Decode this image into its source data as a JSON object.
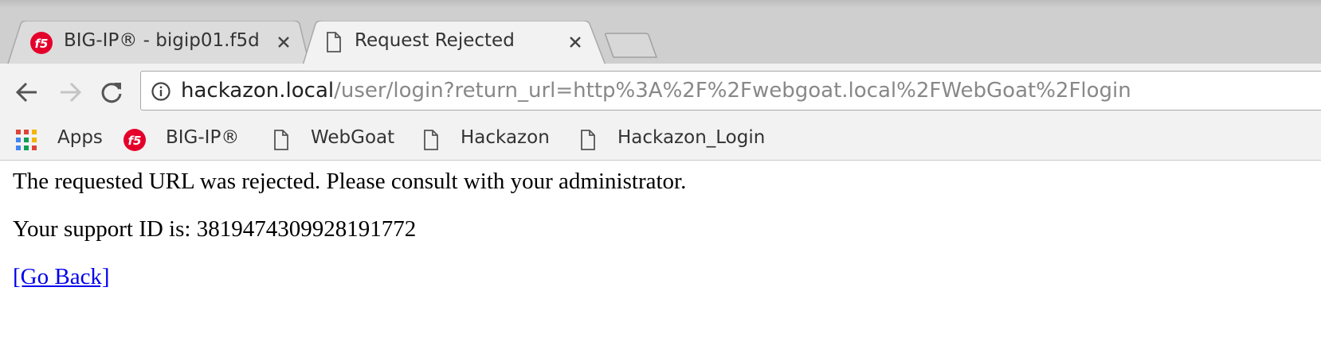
{
  "tabs": [
    {
      "title": "BIG-IP® - bigip01.f5d",
      "favicon": "f5-logo-icon",
      "active": false
    },
    {
      "title": "Request Rejected",
      "favicon": "page-icon",
      "active": true
    }
  ],
  "toolbar": {
    "url_host": "hackazon.local",
    "url_path": "/user/login?return_url=http%3A%2F%2Fwebgoat.local%2FWebGoat%2Flogin"
  },
  "bookmarks": [
    {
      "label": "Apps",
      "icon": "apps-grid-icon"
    },
    {
      "label": "BIG-IP®",
      "icon": "f5-logo-icon"
    },
    {
      "label": "WebGoat",
      "icon": "page-icon"
    },
    {
      "label": "Hackazon",
      "icon": "page-icon"
    },
    {
      "label": "Hackazon_Login",
      "icon": "page-icon"
    }
  ],
  "page": {
    "message": "The requested URL was rejected. Please consult with your administrator.",
    "support_id_label": "Your support ID is: 3819474309928191772",
    "go_back": "[Go Back]"
  },
  "colors": {
    "link": "#0000ee",
    "f5_red": "#e4002b",
    "tabstrip": "#cfcfcf",
    "toolbar": "#f2f2f2"
  }
}
